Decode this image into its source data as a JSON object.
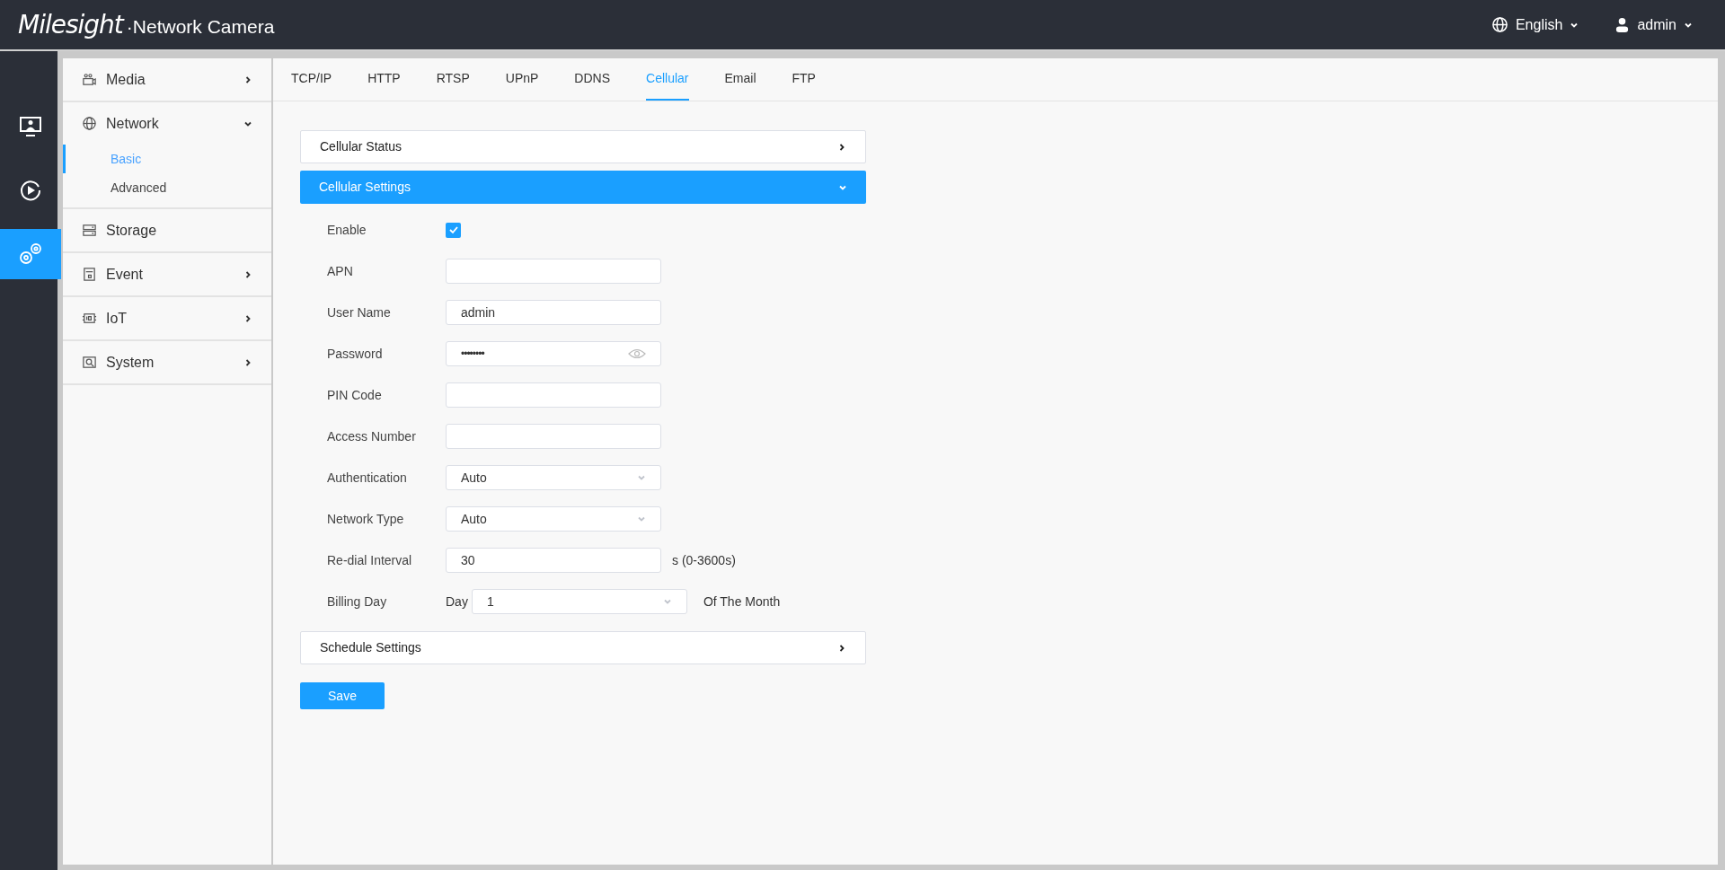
{
  "header": {
    "brand": "Milesight",
    "product": "·Network Camera",
    "language": "English",
    "user": "admin"
  },
  "rail": [
    {
      "selected": false
    },
    {
      "selected": false
    },
    {
      "selected": true
    }
  ],
  "sidebar": {
    "items": [
      {
        "label": "Media",
        "expandable": true,
        "expanded": false
      },
      {
        "label": "Network",
        "expandable": true,
        "expanded": true,
        "children": [
          {
            "label": "Basic",
            "selected": true
          },
          {
            "label": "Advanced",
            "selected": false
          }
        ]
      },
      {
        "label": "Storage",
        "expandable": false
      },
      {
        "label": "Event",
        "expandable": true,
        "expanded": false
      },
      {
        "label": "IoT",
        "expandable": true,
        "expanded": false
      },
      {
        "label": "System",
        "expandable": true,
        "expanded": false
      }
    ]
  },
  "tabs": [
    {
      "label": "TCP/IP",
      "selected": false
    },
    {
      "label": "HTTP",
      "selected": false
    },
    {
      "label": "RTSP",
      "selected": false
    },
    {
      "label": "UPnP",
      "selected": false
    },
    {
      "label": "DDNS",
      "selected": false
    },
    {
      "label": "Cellular",
      "selected": true
    },
    {
      "label": "Email",
      "selected": false
    },
    {
      "label": "FTP",
      "selected": false
    }
  ],
  "sections": [
    {
      "title": "Cellular Status",
      "expanded": false
    },
    {
      "title": "Cellular Settings",
      "expanded": true,
      "fields": [
        {
          "kind": "checkbox",
          "label": "Enable",
          "checked": true
        },
        {
          "kind": "text",
          "label": "APN"
        },
        {
          "kind": "text",
          "label": "User Name",
          "value": "admin"
        },
        {
          "kind": "password",
          "label": "Password",
          "value": "••••••••"
        },
        {
          "kind": "text",
          "label": "PIN Code"
        },
        {
          "kind": "text",
          "label": "Access Number"
        },
        {
          "kind": "select",
          "label": "Authentication",
          "value": "Auto"
        },
        {
          "kind": "select",
          "label": "Network Type",
          "value": "Auto"
        },
        {
          "kind": "text",
          "label": "Re-dial Interval",
          "value": "30",
          "suffix": "s (0-3600s)"
        },
        {
          "kind": "select",
          "label": "Billing Day",
          "prefix": "Day",
          "value": "1",
          "suffix": "Of The Month"
        }
      ]
    },
    {
      "title": "Schedule Settings",
      "expanded": false
    }
  ],
  "save_button": "Save"
}
